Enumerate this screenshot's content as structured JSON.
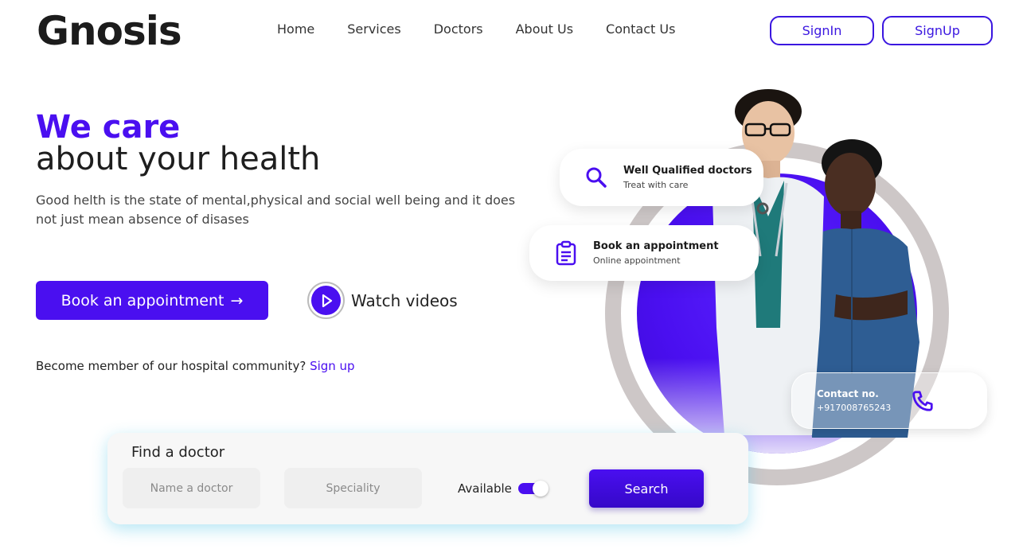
{
  "brand": {
    "name": "Gnosis"
  },
  "nav": {
    "items": [
      "Home",
      "Services",
      "Doctors",
      "About Us",
      "Contact Us"
    ]
  },
  "auth": {
    "signin_label": "SignIn",
    "signup_label": "SignUp"
  },
  "hero": {
    "headline_accent": "We care",
    "headline_rest": "about your health",
    "description": "Good helth is the state of mental,physical and social well being and it does not just mean absence of disases",
    "book_button_label": "Book an appointment",
    "book_button_arrow": "→",
    "watch_label": "Watch videos",
    "member_text": "Become member of our hospital community?",
    "member_link": "Sign up"
  },
  "cards": {
    "qualified": {
      "title": "Well Qualified doctors",
      "subtitle": "Treat with care",
      "icon": "search-icon"
    },
    "appointment": {
      "title": "Book an appointment",
      "subtitle": "Online appointment",
      "icon": "clipboard-icon"
    },
    "contact": {
      "title": "Contact no.",
      "number": "+917008765243",
      "icon": "phone-icon"
    }
  },
  "finder": {
    "title": "Find a doctor",
    "name_placeholder": "Name a doctor",
    "speciality_placeholder": "Speciality",
    "available_label": "Available",
    "available_on": true,
    "search_label": "Search"
  },
  "colors": {
    "accent": "#4a0ff0",
    "ring": "#cdc7c7",
    "text": "#222222"
  }
}
